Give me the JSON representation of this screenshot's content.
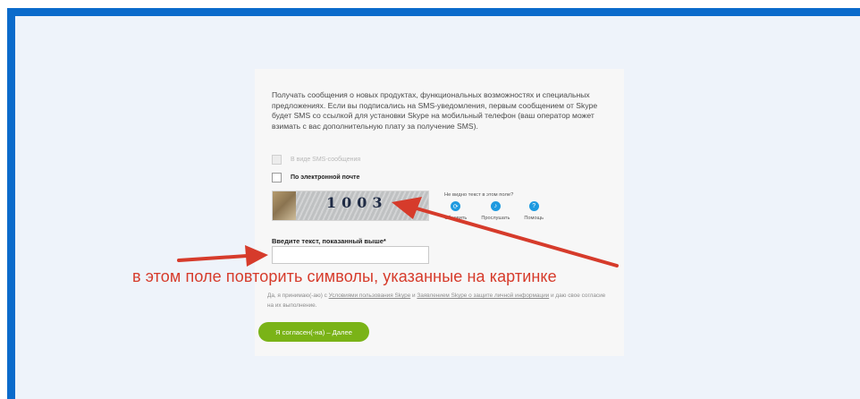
{
  "form": {
    "intro_text": "Получать сообщения о новых продуктах, функциональных возможностях и специальных предложениях. Если вы подписались на SMS-уведомления, первым сообщением от Skype будет SMS со ссылкой для установки Skype на мобильный телефон (ваш оператор может взимать с вас дополнительную плату за получение SMS).",
    "option_sms_label": "В виде SMS-сообщения",
    "option_email_label": "По электронной почте",
    "captcha": {
      "digits": "1003",
      "help_text": "Не видно текст в этом поле?",
      "refresh_label": "Обновить",
      "listen_label": "Прослушать",
      "help_label": "Помощь"
    },
    "input_label": "Введите текст, показанный выше*",
    "input_value": "",
    "legal": {
      "prefix": "Да, я принимаю(-аю) с ",
      "terms_link": "Условиями пользования Skype",
      "middle": " и ",
      "privacy_link": "Заявлением Skype о защите личной информации",
      "suffix": " и даю свое согласие на их выполнение."
    },
    "agree_button": "Я согласен(-на) – Далее"
  },
  "annotation": {
    "callout_text": "в этом поле повторить символы, указанные на картинке",
    "color": "#d63b2b"
  },
  "colors": {
    "frame": "#0b6bcb",
    "backdrop": "#eef3fa",
    "button": "#7ab317",
    "icon": "#1e9ae0"
  },
  "icons": {
    "refresh": "refresh-icon",
    "listen": "speaker-icon",
    "help": "question-icon"
  }
}
